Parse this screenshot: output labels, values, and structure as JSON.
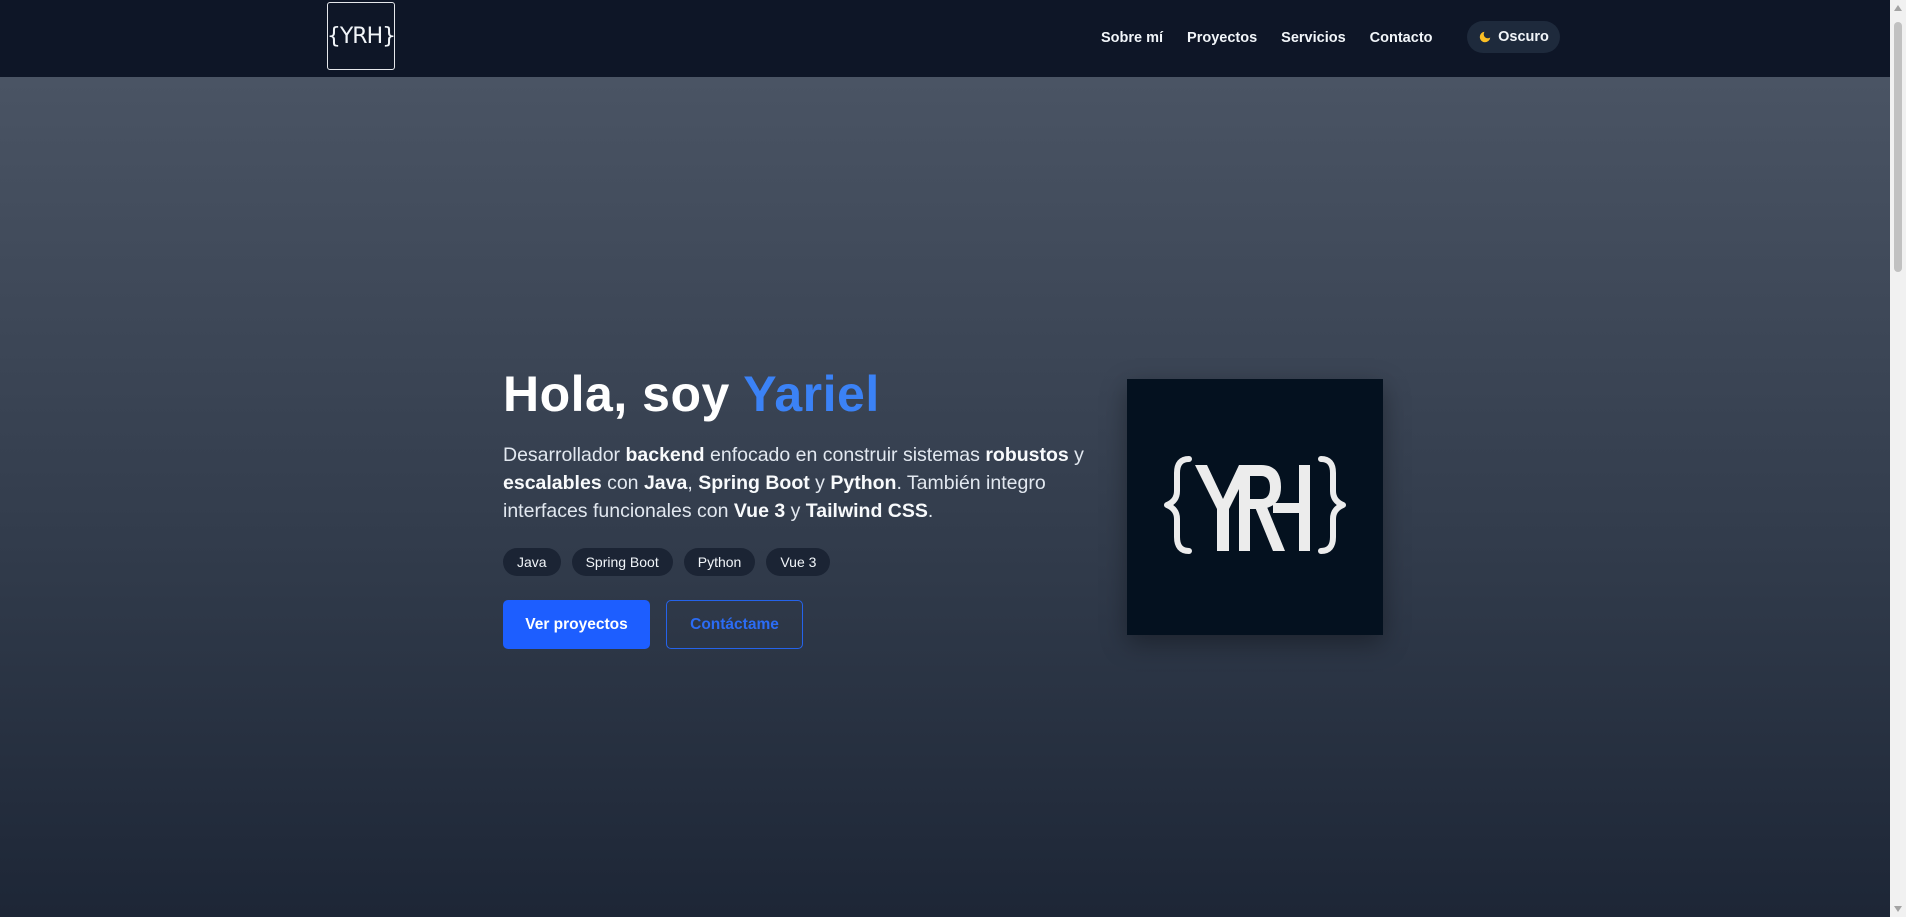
{
  "header": {
    "logo_text": "{YRH}",
    "nav": [
      "Sobre mí",
      "Proyectos",
      "Servicios",
      "Contacto"
    ],
    "theme_toggle": {
      "icon": "moon-icon",
      "label": "Oscuro"
    }
  },
  "hero": {
    "title_prefix": "Hola, soy ",
    "title_name": "Yariel",
    "description": {
      "t1": "Desarrollador ",
      "b1": "backend",
      "t2": " enfocado en construir sistemas ",
      "b2": "robustos",
      "t3": " y ",
      "b3": "escalables",
      "t4": " con ",
      "b4": "Java",
      "t5": ", ",
      "b5": "Spring Boot",
      "t6": " y ",
      "b6": "Python",
      "t7": ". También integro interfaces funcionales con ",
      "b7": "Vue 3",
      "t8": " y ",
      "b8": "Tailwind CSS",
      "t9": "."
    },
    "tags": [
      "Java",
      "Spring Boot",
      "Python",
      "Vue 3"
    ],
    "primary_button": "Ver proyectos",
    "secondary_button": "Contáctame",
    "logo_text": "{YRH}"
  },
  "colors": {
    "accent": "#3b82f6",
    "primary_button": "#1d5eff",
    "header_bg": "#0e1627"
  }
}
